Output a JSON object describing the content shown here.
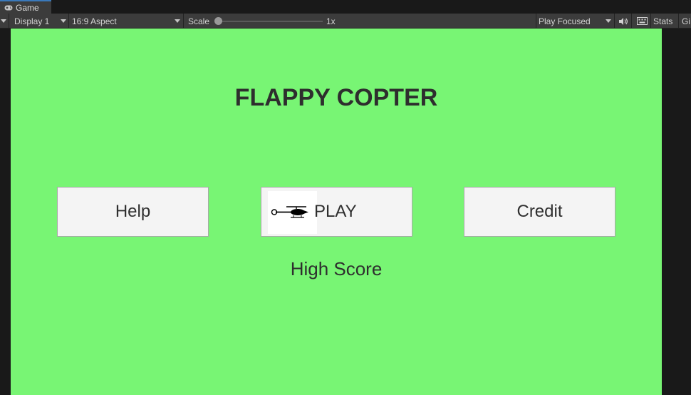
{
  "window": {
    "tab_label": "Game",
    "tab_icon": "gamepad-icon"
  },
  "toolbar": {
    "display": "Display 1",
    "aspect": "16:9 Aspect",
    "scale_label": "Scale",
    "scale_value": "1x",
    "play_mode": "Play Focused",
    "audio_icon": "speaker-icon",
    "keyboard_icon": "keyboard-icon",
    "stats_label": "Stats",
    "gizmos_label": "Gi"
  },
  "game": {
    "background_color": "#78f574",
    "title": "FLAPPY COPTER",
    "buttons": {
      "help": "Help",
      "play": "PLAY",
      "credit": "Credit"
    },
    "play_icon": "helicopter-icon",
    "high_score_label": "High Score"
  }
}
